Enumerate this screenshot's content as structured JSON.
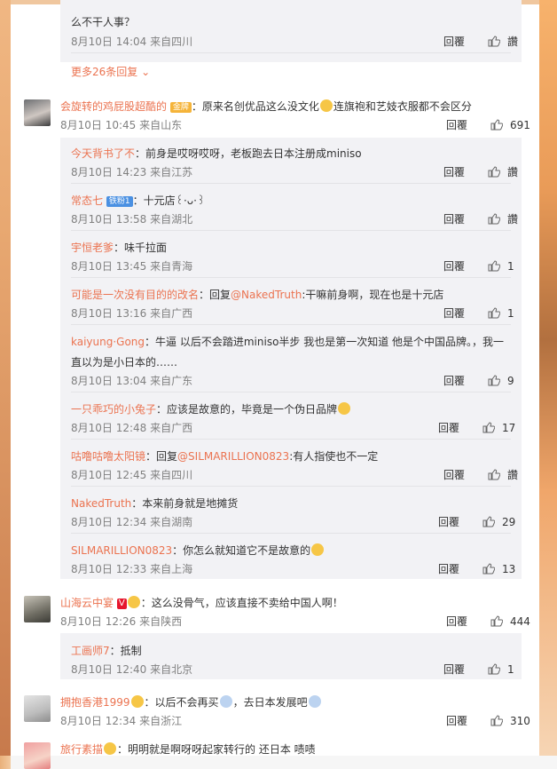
{
  "top": {
    "trail_text": "么不干人事？",
    "meta": "8月10日 14:04 来自四川",
    "reply": "回覆",
    "like": "讚"
  },
  "more_replies": "更多26条回复",
  "comments": [
    {
      "name": "会旋转的鸡屁股超酷的",
      "badge": "金牌",
      "text_before": "：原来名创优品这么没文化",
      "text_after": "连旗袍和艺妓衣服都不会区分",
      "meta": "8月10日 10:45 来自山东",
      "reply": "回覆",
      "like": "691"
    },
    {
      "name": "山海云中宴",
      "badge_v": "V",
      "text": "：这么没骨气，应该直接不卖给中国人啊！",
      "meta": "8月10日 12:26 来自陕西",
      "reply": "回覆",
      "like": "444"
    },
    {
      "name": "拥抱香港1999",
      "text_before": "：以后不会再买",
      "text_after": "，去日本发展吧",
      "meta": "8月10日 12:34 来自浙江",
      "reply": "回覆",
      "like": "310"
    },
    {
      "name": "旅行素描",
      "text": "：明明就是啊呀呀起家转行的 还日本 啧啧"
    }
  ],
  "replies1": [
    {
      "name": "今天背书了不",
      "text": "：前身是哎呀哎呀，老板跑去日本注册成miniso",
      "meta": "8月10日 14:23 来自江苏",
      "reply": "回覆",
      "like": "讚"
    },
    {
      "name": "常态七",
      "badge": "铁粉1",
      "text": "：十元店꒰·ᴗ·꒱",
      "meta": "8月10日 13:58 来自湖北",
      "reply": "回覆",
      "like": "讚"
    },
    {
      "name": "宇恒老爹",
      "text": "：味千拉面",
      "meta": "8月10日 13:45 来自青海",
      "reply": "回覆",
      "like": "1"
    },
    {
      "name": "可能是一次没有目的的改名",
      "text": "：回复",
      "mention": "@NakedTruth",
      "text2": ":干嘛前身啊，现在也是十元店",
      "meta": "8月10日 13:16 来自广西",
      "reply": "回覆",
      "like": "1"
    },
    {
      "name": "kaiyung·Gong",
      "text": "：牛逼 以后不会踏进miniso半步 我也是第一次知道 他是个中国品牌。，我一",
      "text_line2": "直以为是小日本的……",
      "meta": "8月10日 13:04 来自广东",
      "reply": "回覆",
      "like": "9"
    },
    {
      "name": "一只乖巧的小兔子",
      "text": "：应该是故意的，毕竟是一个伪日品牌",
      "meta": "8月10日 12:48 来自广西",
      "reply": "回覆",
      "like": "17"
    },
    {
      "name": "咕噜咕噜太阳镜",
      "text": "：回复",
      "mention": "@SILMARILLION0823",
      "text2": ":有人指使也不一定",
      "meta": "8月10日 12:45 来自四川",
      "reply": "回覆",
      "like": "讚"
    },
    {
      "name": "NakedTruth",
      "text": "：本来前身就是地摊货",
      "meta": "8月10日 12:34 来自湖南",
      "reply": "回覆",
      "like": "29"
    },
    {
      "name": "SILMARILLION0823",
      "text": "：你怎么就知道它不是故意的",
      "meta": "8月10日 12:33 来自上海",
      "reply": "回覆",
      "like": "13"
    }
  ],
  "replies2": [
    {
      "name": "工画师7",
      "text": "：抵制",
      "meta": "8月10日 12:40 来自北京",
      "reply": "回覆",
      "like": "1"
    }
  ],
  "colors": {
    "accent": "#eb7350",
    "text": "#333333",
    "meta": "#808080",
    "reply_bg": "#f2f2f5"
  }
}
